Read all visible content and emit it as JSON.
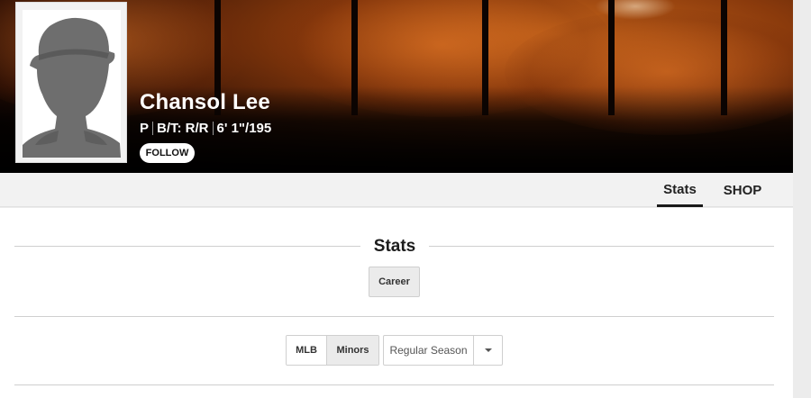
{
  "player": {
    "name": "Chansol Lee",
    "position": "P",
    "bats_throws": "B/T: R/R",
    "height_weight": "6' 1\"/195",
    "follow_label": "FOLLOW"
  },
  "tabs": [
    {
      "label": "Stats",
      "active": true
    },
    {
      "label": "SHOP",
      "active": false
    }
  ],
  "stats": {
    "title": "Stats",
    "career_label": "Career",
    "league_options": [
      {
        "label": "MLB",
        "selected": false
      },
      {
        "label": "Minors",
        "selected": true
      }
    ],
    "season_select": {
      "value": "Regular Season"
    }
  },
  "icons": {
    "photo": "player-silhouette-icon",
    "dropdown": "chevron-down-icon"
  },
  "colors": {
    "hero_background": "#3b1606",
    "accent_text": "#ffffff",
    "active_tab_underline": "#1a1a1a"
  }
}
